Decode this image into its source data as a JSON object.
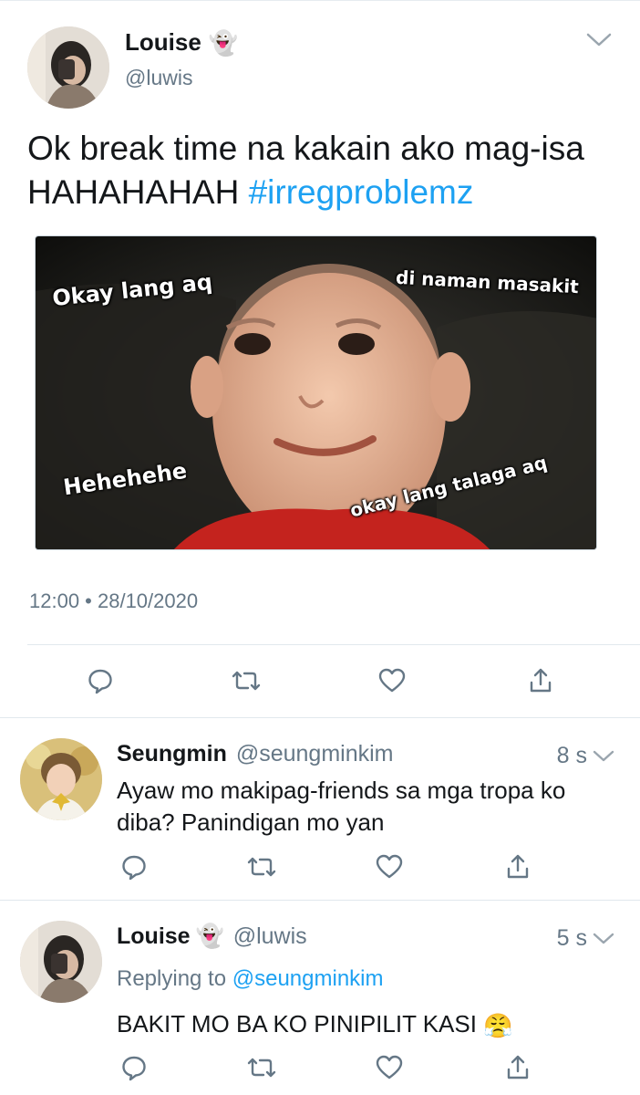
{
  "main_tweet": {
    "author_name": "Louise",
    "author_emoji": "👻",
    "author_handle": "@luwis",
    "text_line1": "Ok break time na kakain ako mag-isa",
    "text_line2": "HAHAHAHAH",
    "hashtag": "#irregproblemz",
    "meme_captions": [
      "Okay lang aq",
      "di naman masakit",
      "Hehehehe",
      "okay lang talaga aq"
    ],
    "timestamp": "12:00 • 28/10/2020"
  },
  "replies": [
    {
      "author_name": "Seungmin",
      "author_handle": "@seungminkim",
      "time": "8 s",
      "text": "Ayaw mo makipag-friends sa mga tropa ko diba? Panindigan mo yan"
    },
    {
      "author_name": "Louise",
      "author_emoji": "👻",
      "author_handle": "@luwis",
      "time": "5 s",
      "replying_prefix": "Replying to",
      "replying_to": "@seungminkim",
      "text": "BAKIT MO BA KO PINIPILIT KASI",
      "trailing_emoji": "😤"
    }
  ],
  "icons": {
    "reply": "reply-icon",
    "retweet": "retweet-icon",
    "like": "like-icon",
    "share": "share-icon",
    "menu": "chevron-down-icon"
  },
  "colors": {
    "accent": "#1da1f2",
    "secondary_text": "#657786",
    "primary_text": "#14171a",
    "border": "#e1e8ed"
  }
}
